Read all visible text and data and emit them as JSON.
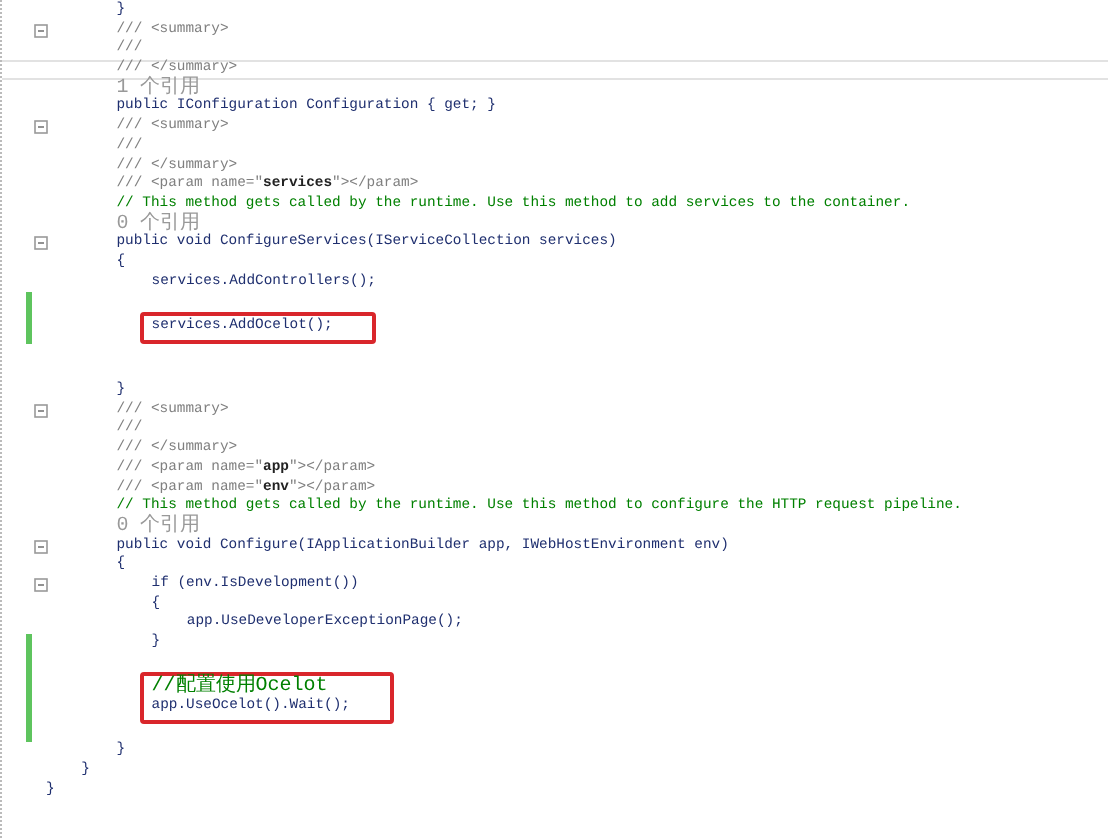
{
  "editor": {
    "lines": [
      {
        "kind": "group",
        "children": [
          {
            "kind": "group",
            "children": [
              {
                "kind": "code",
                "text": "}"
              },
              {
                "kind": "doc",
                "fold": true,
                "text": "/// <summary>"
              },
              {
                "kind": "doc",
                "text": "///"
              },
              {
                "kind": "doc",
                "current": true,
                "text": "/// </summary>"
              },
              {
                "kind": "lens",
                "text": "1 个引用"
              },
              {
                "kind": "code",
                "text": "public IConfiguration Configuration { get; }"
              },
              {
                "kind": "doc",
                "fold": true,
                "text": "/// <summary>"
              },
              {
                "kind": "doc",
                "text": "///"
              },
              {
                "kind": "doc",
                "text": "/// </summary>"
              },
              {
                "kind": "doc",
                "text": "/// <param name=\"**services**\"></param>"
              },
              {
                "kind": "comment",
                "text": "// This method gets called by the runtime. Use this method to add services to the container."
              },
              {
                "kind": "lens",
                "text": "0 个引用"
              },
              {
                "kind": "code",
                "fold": true,
                "text": "public void ConfigureServices(IServiceCollection services)"
              },
              {
                "kind": "code",
                "text": "{"
              },
              {
                "kind": "group",
                "children": [
                  {
                    "kind": "code",
                    "text": "services.AddControllers();"
                  },
                  {
                    "kind": "blank",
                    "changed": true
                  },
                  {
                    "kind": "code",
                    "changed": true,
                    "boxed": true,
                    "text": "services.AddOcelot();"
                  },
                  {
                    "kind": "blank"
                  },
                  {
                    "kind": "blank"
                  }
                ]
              },
              {
                "kind": "code",
                "text": "}"
              },
              {
                "kind": "doc",
                "fold": true,
                "text": "/// <summary>"
              },
              {
                "kind": "doc",
                "text": "///"
              },
              {
                "kind": "doc",
                "text": "/// </summary>"
              },
              {
                "kind": "doc",
                "text": "/// <param name=\"**app**\"></param>"
              },
              {
                "kind": "doc",
                "text": "/// <param name=\"**env**\"></param>"
              },
              {
                "kind": "comment",
                "text": "// This method gets called by the runtime. Use this method to configure the HTTP request pipeline."
              },
              {
                "kind": "lens",
                "text": "0 个引用"
              },
              {
                "kind": "code",
                "fold": true,
                "text": "public void Configure(IApplicationBuilder app, IWebHostEnvironment env)"
              },
              {
                "kind": "code",
                "text": "{"
              },
              {
                "kind": "group",
                "children": [
                  {
                    "kind": "code",
                    "fold": true,
                    "text": "if (env.IsDevelopment())"
                  },
                  {
                    "kind": "code",
                    "text": "{"
                  },
                  {
                    "kind": "group",
                    "children": [
                      {
                        "kind": "code",
                        "text": "app.UseDeveloperExceptionPage();"
                      }
                    ]
                  },
                  {
                    "kind": "code",
                    "changed": true,
                    "text": "}"
                  },
                  {
                    "kind": "blank",
                    "changed": true
                  },
                  {
                    "kind": "comment",
                    "changed": true,
                    "boxed": true,
                    "text": "//配置使用Ocelot"
                  },
                  {
                    "kind": "code",
                    "changed": true,
                    "boxed": true,
                    "text": "app.UseOcelot().Wait();"
                  },
                  {
                    "kind": "blank",
                    "changed": true
                  }
                ]
              },
              {
                "kind": "code",
                "text": "}"
              }
            ]
          },
          {
            "kind": "code",
            "text": "}"
          }
        ]
      },
      {
        "kind": "code",
        "text": "}"
      }
    ]
  }
}
